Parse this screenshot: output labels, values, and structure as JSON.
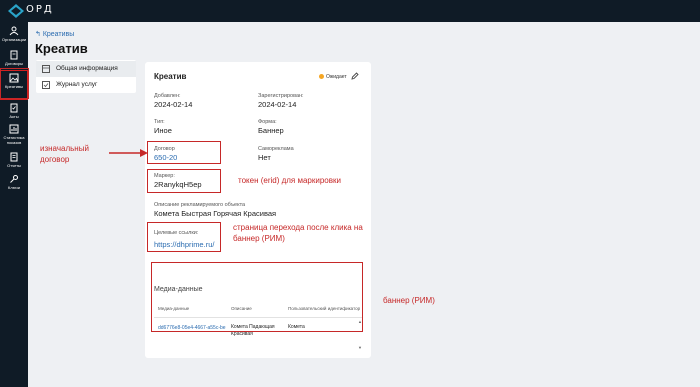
{
  "app": {
    "logo_text": "ОРД"
  },
  "sidebar": {
    "items": [
      {
        "label": "Организации",
        "icon": "users-icon"
      },
      {
        "label": "Договоры",
        "icon": "contract-icon"
      },
      {
        "label": "Креативы",
        "icon": "image-icon",
        "active": true
      },
      {
        "label": "Акты",
        "icon": "act-icon"
      },
      {
        "label": "Статистика показов",
        "icon": "stats-icon"
      },
      {
        "label": "Отчеты",
        "icon": "report-icon"
      },
      {
        "label": "Ключи",
        "icon": "key-icon"
      }
    ]
  },
  "header": {
    "back": "Креативы",
    "title": "Креатив"
  },
  "menu": {
    "items": [
      {
        "label": "Общая информация",
        "active": true
      },
      {
        "label": "Журнал услуг"
      }
    ]
  },
  "card": {
    "title": "Креатив",
    "status": "Ожидает",
    "fields": {
      "added_label": "Добавлен:",
      "added_value": "2024-02-14",
      "registered_label": "Зарегистрирован:",
      "registered_value": "2024-02-14",
      "type_label": "Тип:",
      "type_value": "Иное",
      "form_label": "Форма:",
      "form_value": "Баннер",
      "contract_label": "Договор",
      "contract_value": "650-20",
      "selfad_label": "Самореклама",
      "selfad_value": "Нет",
      "marker_label": "Маркер:",
      "marker_value": "2RanykqH5ep",
      "desc_label": "Описание рекламируемого объекта",
      "desc_value": "Комета Быстрая Горячая Красивая",
      "urls_label": "Целевые ссылки:",
      "urls_value": "https://dhprime.ru/"
    },
    "media": {
      "title": "Медиа-данные",
      "columns": [
        "Медиа-данные",
        "Описание",
        "Пользовательский идентификатор"
      ],
      "row": {
        "media": "dd6776e8-05e4-4667-a55c-be",
        "description": "Комета Падающая Красивая",
        "user_id": "Комета"
      }
    }
  },
  "annotations": {
    "contract": "изначальный договор",
    "marker": "токен (erid) для маркировки",
    "urls": "страница перехода после клика на баннер (РИМ)",
    "banner": "баннер (РИМ)"
  },
  "colors": {
    "sidebar": "#0f1b26",
    "accent": "#2b6cb0",
    "annotation": "#c62828",
    "status": "#f5a623"
  }
}
